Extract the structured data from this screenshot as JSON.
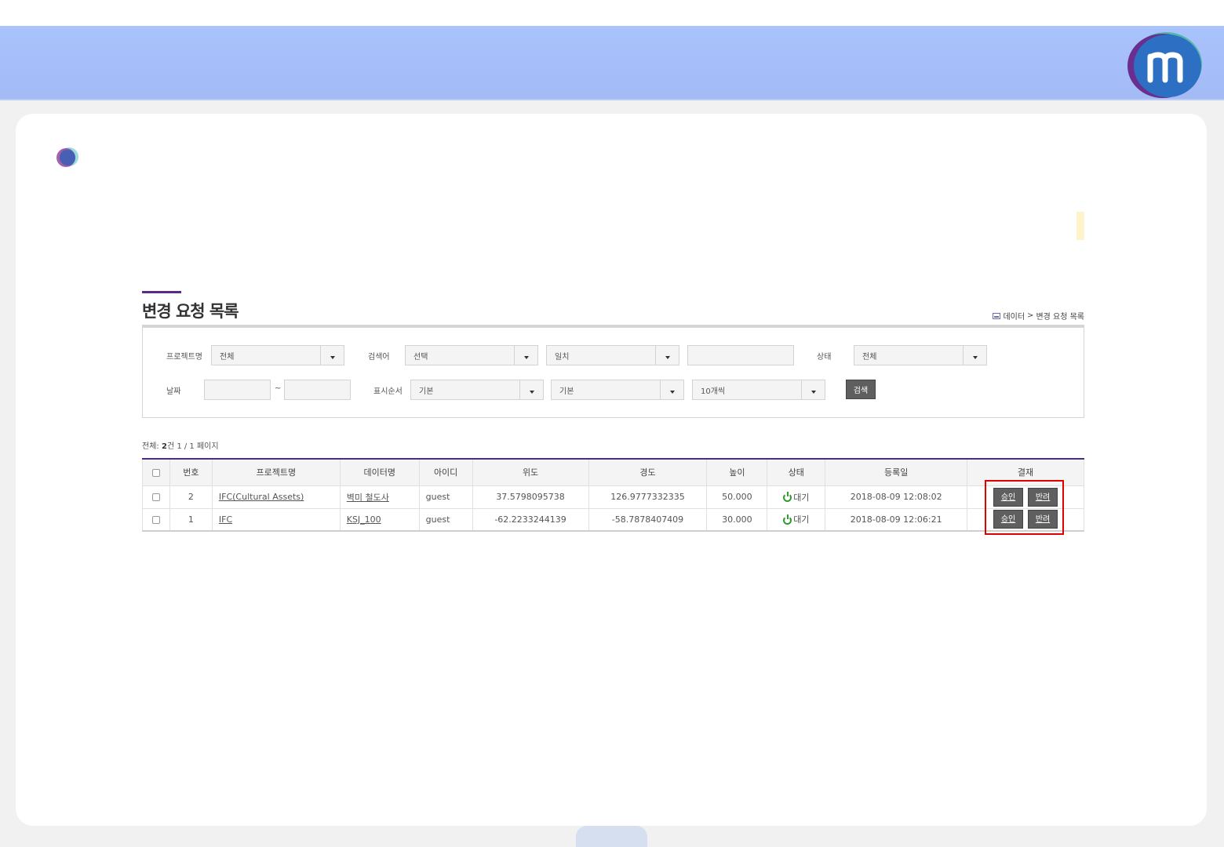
{
  "page": {
    "title": "변경 요청 목록",
    "breadcrumb": {
      "section": "데이터",
      "separator": ">",
      "current": "변경 요청 목록"
    }
  },
  "filters": {
    "project_label": "프로젝트명",
    "project_value": "전체",
    "search_label": "검색어",
    "search_field_value": "선택",
    "match_value": "일치",
    "keyword_value": "",
    "status_label": "상태",
    "status_value": "전체",
    "date_label": "날짜",
    "date_separator": "~",
    "order_label": "표시순서",
    "order_field_value": "기본",
    "order_dir_value": "기본",
    "page_size_value": "10개씩",
    "search_button": "검색"
  },
  "summary": {
    "prefix": "전체:",
    "count": "2",
    "unit": "건",
    "pages": "1 / 1 페이지"
  },
  "table": {
    "headers": [
      "번호",
      "프로젝트명",
      "데이터명",
      "아이디",
      "위도",
      "경도",
      "높이",
      "상태",
      "등록일",
      "결재"
    ],
    "rows": [
      {
        "no": "2",
        "project": "IFC(Cultural Assets)",
        "data_name": "벽미 철도사",
        "user_id": "guest",
        "lat": "37.5798095738",
        "lon": "126.9777332335",
        "height": "50.000",
        "status": "대기",
        "registered": "2018-08-09 12:08:02",
        "approve": "승인",
        "reject": "반려"
      },
      {
        "no": "1",
        "project": "IFC",
        "data_name": "KSJ_100",
        "user_id": "guest",
        "lat": "-62.2233244139",
        "lon": "-58.7878407409",
        "height": "30.000",
        "status": "대기",
        "registered": "2018-08-09 12:06:21",
        "approve": "승인",
        "reject": "반려"
      }
    ]
  },
  "colors": {
    "accent": "#4a2c80",
    "banner": "#a6befa",
    "highlight": "#e00000",
    "status_ok": "#2e9c2e"
  }
}
